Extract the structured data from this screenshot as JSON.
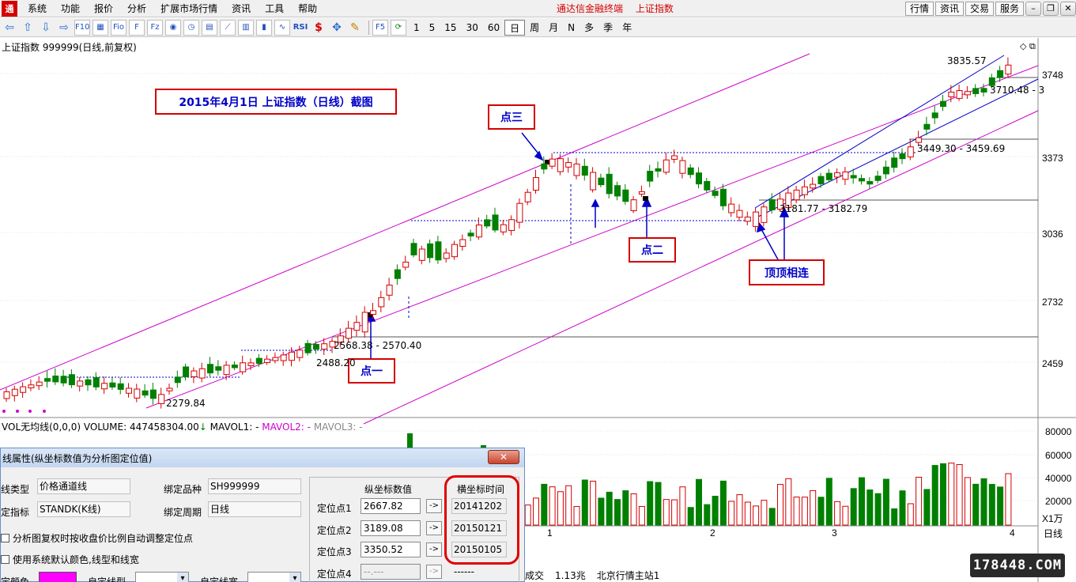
{
  "menubar": {
    "logo": "通",
    "items": [
      "系统",
      "功能",
      "报价",
      "分析",
      "扩展市场行情",
      "资讯",
      "工具",
      "帮助"
    ],
    "title_app": "通达信金融终端",
    "title_symbol": "上证指数",
    "right_buttons": [
      "行情",
      "资讯",
      "交易",
      "服务"
    ]
  },
  "toolbar": {
    "icons": [
      "F10",
      "Fio",
      "F",
      "Fz",
      "RSI",
      "$"
    ],
    "periods": [
      "1",
      "5",
      "15",
      "30",
      "60",
      "日",
      "周",
      "月",
      "N",
      "多",
      "季",
      "年"
    ],
    "active_period": "日"
  },
  "chart": {
    "header": "上证指数 999999(日线,前复权)",
    "caption": "2015年4月1日  上证指数（日线）截图",
    "y_ticks": [
      "3748",
      "3373",
      "3036",
      "2732",
      "2459"
    ],
    "vol_ticks": [
      "80000",
      "60000",
      "40000",
      "20000",
      "X1万"
    ],
    "x_ticks": [
      "1",
      "2",
      "3",
      "4"
    ],
    "annotations": {
      "point1": "点一",
      "point2": "点二",
      "point3": "点三",
      "top_connect": "顶顶相连"
    },
    "price_labels": [
      "3835.57",
      "3710.48 - 3",
      "3449.30 - 3459.69",
      "3181.77 - 3182.79",
      "2568.38 - 2570.40",
      "2488.20",
      "2279.84"
    ]
  },
  "volume": {
    "label": "VOL无均线(0,0,0)",
    "volume": "VOLUME: 447458304.00",
    "mavol1": "MAVOL1: -",
    "mavol2": "MAVOL2: -",
    "mavol3": "MAVOL3: -"
  },
  "dialog": {
    "title": "线属性(纵坐标数值为分析图定位值)",
    "line_type_label": "线类型",
    "line_type_value": "价格通道线",
    "bind_symbol_label": "绑定品种",
    "bind_symbol_value": "SH999999",
    "indicator_label": "定指标",
    "indicator_value": "STANDK(K线)",
    "bind_period_label": "绑定周期",
    "bind_period_value": "日线",
    "checkbox1": "分析图复权时按收盘价比例自动调整定位点",
    "checkbox2": "使用系统默认颜色,线型和线宽",
    "color_label": "定颜色",
    "line_style_label": "自定线型",
    "line_width_label": "自定线宽",
    "col_y": "纵坐标数值",
    "col_x": "横坐标时间",
    "points": [
      {
        "label": "定位点1",
        "value": "2667.82",
        "time": "20141202"
      },
      {
        "label": "定位点2",
        "value": "3189.08",
        "time": "20150121"
      },
      {
        "label": "定位点3",
        "value": "3350.52",
        "time": "20150105"
      },
      {
        "label": "定位点4",
        "value": "--.---",
        "time": "------"
      }
    ],
    "arrow": "->"
  },
  "statusbar": {
    "amount_label": "成交",
    "amount": "1.13兆",
    "server": "北京行情主站1"
  },
  "side": {
    "day_tag": "日线"
  },
  "watermark": "178448.COM",
  "colors": {
    "up": "#d40000",
    "down": "#008000",
    "channel": "#cc00cc",
    "trend": "#0000c8"
  }
}
